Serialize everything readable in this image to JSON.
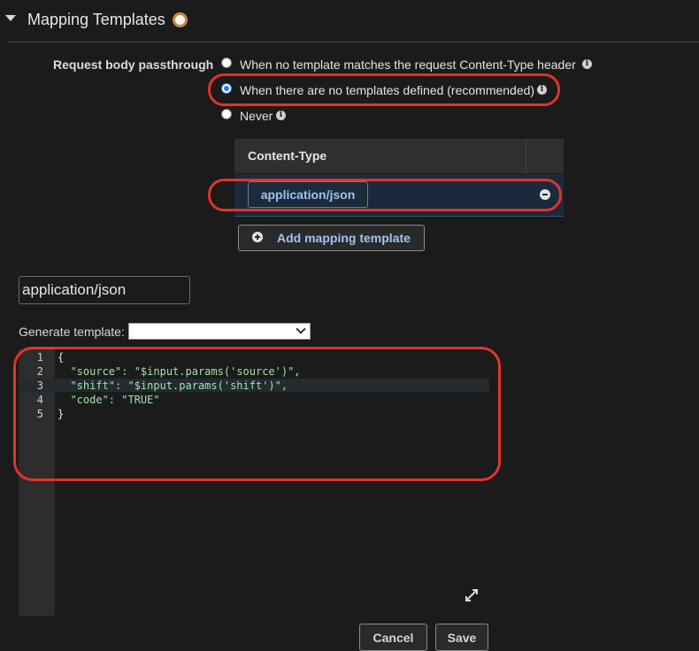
{
  "section": {
    "title": "Mapping Templates"
  },
  "passthrough": {
    "label": "Request body passthrough",
    "options": [
      {
        "label": "When no template matches the request Content-Type header",
        "selected": false
      },
      {
        "label": "When there are no templates defined (recommended)",
        "selected": true
      },
      {
        "label": "Never",
        "selected": false
      }
    ]
  },
  "content_types": {
    "header": "Content-Type",
    "rows": [
      {
        "value": "application/json"
      }
    ],
    "add_button_label": "Add mapping template"
  },
  "editor": {
    "content_type_value": "application/json",
    "generate_label": "Generate template:",
    "generate_selected": "",
    "line_numbers": [
      "1",
      "2",
      "3",
      "4",
      "5"
    ],
    "lines": [
      "{",
      "  \"source\": \"$input.params('source')\",",
      "  \"shift\": \"$input.params('shift')\",",
      "  \"code\": \"TRUE\"",
      "}"
    ]
  },
  "footer": {
    "cancel_label": "Cancel",
    "save_label": "Save"
  },
  "colors": {
    "accent": "#2f7be2",
    "highlight": "#e2332b",
    "selected_row": "#1a2a3c",
    "link": "#9dc4ef"
  }
}
